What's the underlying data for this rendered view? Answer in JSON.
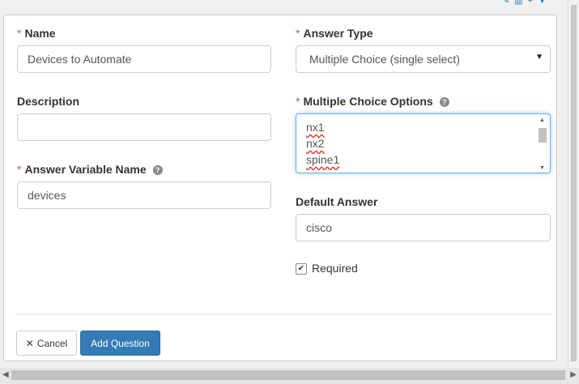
{
  "form": {
    "name": {
      "label": "Name",
      "value": "Devices to Automate"
    },
    "description": {
      "label": "Description",
      "value": ""
    },
    "answer_variable": {
      "label": "Answer Variable Name",
      "value": "devices"
    },
    "answer_type": {
      "label": "Answer Type",
      "selected": "Multiple Choice (single select)"
    },
    "mc_options": {
      "label": "Multiple Choice Options",
      "lines": [
        "nx1",
        "nx2",
        "spine1"
      ]
    },
    "default_answer": {
      "label": "Default Answer",
      "value": "cisco"
    },
    "required": {
      "label": "Required",
      "checked": true
    }
  },
  "actions": {
    "cancel": "Cancel",
    "add": "Add Question"
  },
  "colors": {
    "primary": "#337ab7",
    "required_star": "#d9534f",
    "focus": "#66afe9"
  },
  "icons": [
    "edit-icon",
    "delete-icon",
    "add-icon",
    "collapse-icon",
    "help-icon",
    "close-icon",
    "checkmark-icon"
  ]
}
